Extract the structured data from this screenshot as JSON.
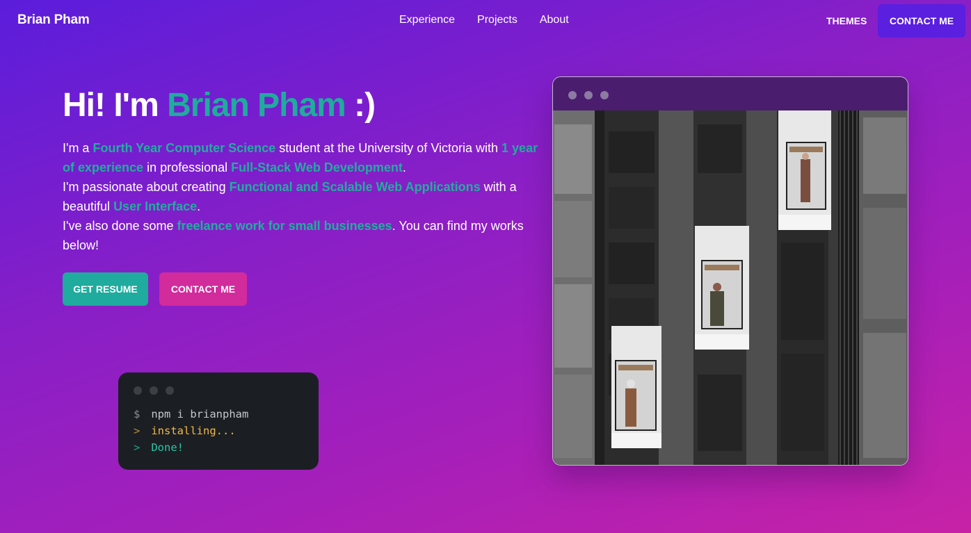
{
  "nav": {
    "brand": "Brian Pham",
    "links": [
      "Experience",
      "Projects",
      "About"
    ],
    "themes": "THEMES",
    "contact": "CONTACT ME"
  },
  "hero": {
    "title_prefix": "Hi! I'm ",
    "title_name": "Brian Pham",
    "title_suffix": " :)",
    "p1": {
      "t1": "I'm a ",
      "h1": "Fourth Year Computer Science",
      "t2": " student at the University of Victoria with ",
      "h2": "1 year of experience",
      "t3": " in professional ",
      "h3": "Full-Stack Web Development",
      "t4": "."
    },
    "p2": {
      "t1": "I'm passionate about creating ",
      "h1": "Functional and Scalable Web Applications",
      "t2": " with a beautiful ",
      "h2": "User Interface",
      "t3": "."
    },
    "p3": {
      "t1": "I've also done some ",
      "h1": "freelance work for small businesses",
      "t2": ". You can find my works below!"
    },
    "resume_button": "GET RESUME",
    "contact_button": "CONTACT ME"
  },
  "terminal": {
    "lines": [
      {
        "prompt": "$",
        "text": "npm i brianpham"
      },
      {
        "prompt": ">",
        "text": "installing..."
      },
      {
        "prompt": ">",
        "text": "Done!"
      }
    ]
  },
  "colors": {
    "accent_teal": "#1fac9d",
    "accent_pink": "#d22b9c",
    "accent_purple": "#5a1fdf"
  },
  "icons": [
    "window-dot-icon"
  ]
}
